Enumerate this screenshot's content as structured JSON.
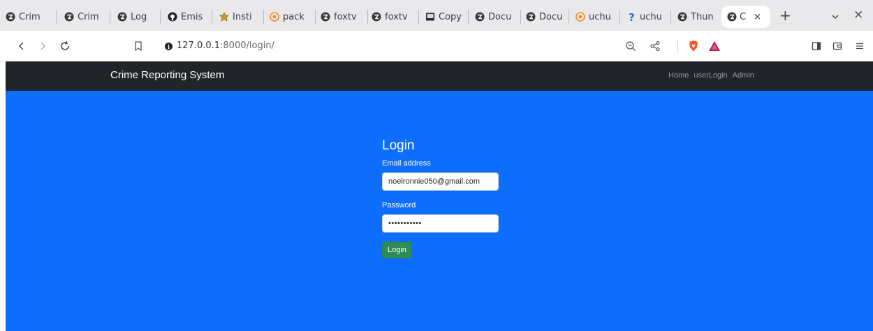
{
  "browser": {
    "tabs": [
      {
        "title": "Crim",
        "icon": "globe-icon"
      },
      {
        "title": "Crim",
        "icon": "globe-icon"
      },
      {
        "title": "Log",
        "icon": "globe-icon"
      },
      {
        "title": "Emis",
        "icon": "github-icon"
      },
      {
        "title": "Insti",
        "icon": "crest-icon"
      },
      {
        "title": "pack",
        "icon": "orange-circle-icon"
      },
      {
        "title": "foxtv",
        "icon": "globe-icon"
      },
      {
        "title": "foxtv",
        "icon": "globe-icon"
      },
      {
        "title": "Copy",
        "icon": "image-icon"
      },
      {
        "title": "Docu",
        "icon": "globe-icon"
      },
      {
        "title": "Docu",
        "icon": "globe-icon"
      },
      {
        "title": "uchu",
        "icon": "orange-circle-icon"
      },
      {
        "title": "uchu",
        "icon": "question-icon"
      },
      {
        "title": "Thun",
        "icon": "globe-icon"
      }
    ],
    "active_tab": {
      "title": "C",
      "icon": "globe-icon",
      "close": "×"
    },
    "new_tab": "+",
    "window_close": "×",
    "url": {
      "host": "127.0.0.1",
      "path": ":8000/login/"
    }
  },
  "navbar": {
    "brand": "Crime Reporting System",
    "links": [
      "Home",
      "userLogin",
      "Admin"
    ]
  },
  "login": {
    "title": "Login",
    "email_label": "Email address",
    "email_value": "noelronnie050@gmail.com",
    "password_label": "Password",
    "password_mask": "•••••••••••",
    "button": "Login"
  },
  "colors": {
    "page_background": "#0d6efd",
    "navbar": "#212529",
    "login_button": "#2e8b57"
  }
}
